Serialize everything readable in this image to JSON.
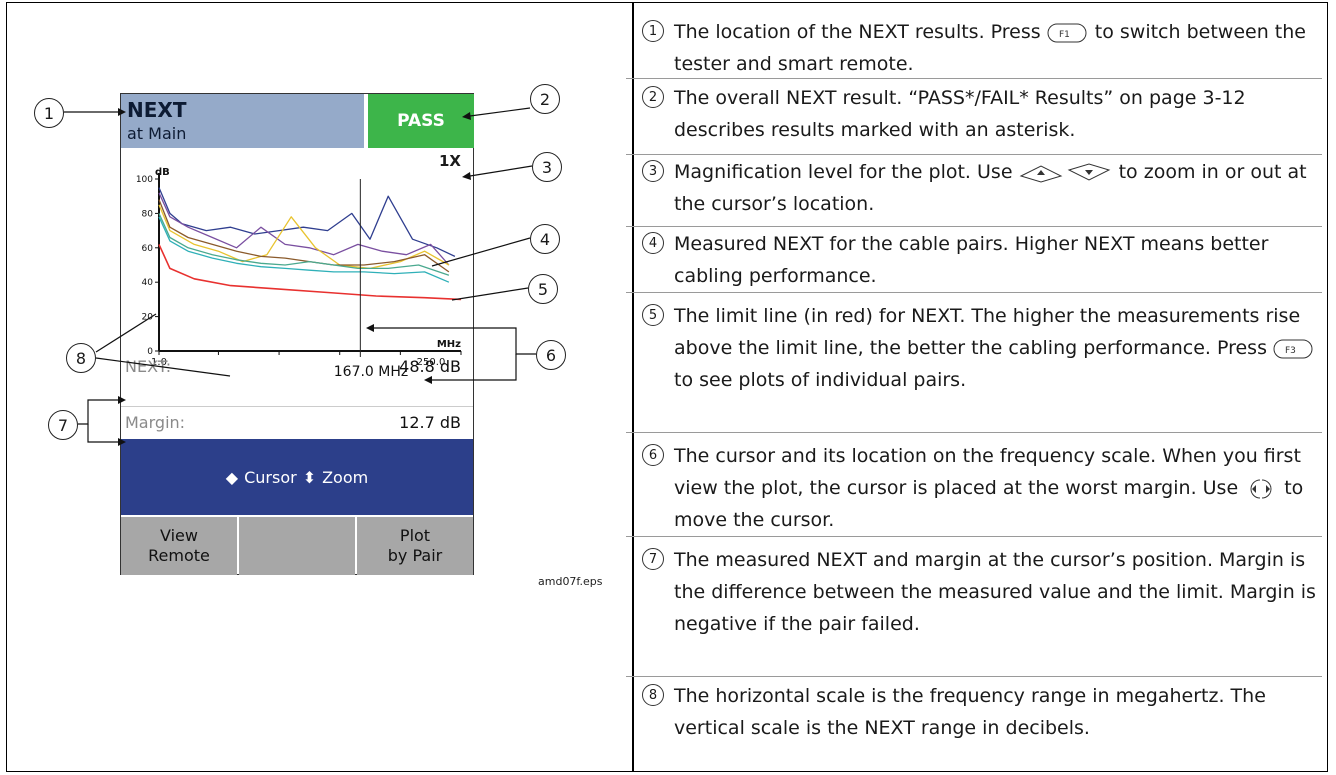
{
  "screen": {
    "title": "NEXT",
    "subtitle": "at Main",
    "result": "PASS",
    "magnification": "1X",
    "readout": [
      {
        "label": "NEXT:",
        "value": "48.8 dB"
      },
      {
        "label": "Margin:",
        "value": "12.7 dB"
      }
    ],
    "nav_bar": {
      "cursor_glyph": "◆",
      "cursor_label": "Cursor",
      "zoom_glyph": "⬍",
      "zoom_label": "Zoom"
    },
    "softkeys": [
      {
        "line1": "View",
        "line2": "Remote"
      },
      {
        "line1": "",
        "line2": ""
      },
      {
        "line1": "Plot",
        "line2": "by Pair"
      }
    ],
    "colors": {
      "header": "#95aac9",
      "pass": "#3db54a",
      "nav": "#2c3f8a",
      "softkey": "#a7a7a7",
      "limit": "#e8312f"
    }
  },
  "chart_data": {
    "type": "line",
    "ylabel": "dB",
    "xlabel": "MHz",
    "ylim": [
      0,
      100
    ],
    "xlim": [
      1.0,
      250.0
    ],
    "yticks": [
      "0",
      "20",
      "40",
      "60",
      "80",
      "100"
    ],
    "xticks": [
      "1.0",
      "250.0"
    ],
    "cursor_label": "167.0 MHz",
    "cursor_x": 167.0,
    "series": [
      {
        "color": "#e8312f",
        "values": [
          [
            1,
            62
          ],
          [
            10,
            48
          ],
          [
            30,
            42
          ],
          [
            60,
            38
          ],
          [
            100,
            36
          ],
          [
            140,
            34
          ],
          [
            180,
            32
          ],
          [
            220,
            31
          ],
          [
            250,
            30
          ]
        ]
      },
      {
        "color": "#2f3e8f",
        "values": [
          [
            1,
            95
          ],
          [
            10,
            80
          ],
          [
            20,
            74
          ],
          [
            40,
            70
          ],
          [
            60,
            72
          ],
          [
            80,
            68
          ],
          [
            100,
            70
          ],
          [
            120,
            72
          ],
          [
            140,
            70
          ],
          [
            160,
            80
          ],
          [
            175,
            65
          ],
          [
            190,
            90
          ],
          [
            210,
            65
          ],
          [
            230,
            60
          ],
          [
            245,
            55
          ]
        ]
      },
      {
        "color": "#7a4fa0",
        "values": [
          [
            1,
            92
          ],
          [
            10,
            78
          ],
          [
            25,
            72
          ],
          [
            45,
            66
          ],
          [
            65,
            60
          ],
          [
            85,
            72
          ],
          [
            105,
            62
          ],
          [
            125,
            60
          ],
          [
            145,
            56
          ],
          [
            165,
            62
          ],
          [
            185,
            58
          ],
          [
            205,
            56
          ],
          [
            225,
            62
          ],
          [
            240,
            50
          ]
        ]
      },
      {
        "color": "#e8c32f",
        "values": [
          [
            1,
            85
          ],
          [
            10,
            70
          ],
          [
            30,
            62
          ],
          [
            50,
            58
          ],
          [
            70,
            52
          ],
          [
            90,
            56
          ],
          [
            110,
            78
          ],
          [
            130,
            60
          ],
          [
            150,
            50
          ],
          [
            175,
            48
          ],
          [
            200,
            52
          ],
          [
            220,
            58
          ],
          [
            240,
            50
          ]
        ]
      },
      {
        "color": "#8a5a2b",
        "values": [
          [
            1,
            88
          ],
          [
            10,
            72
          ],
          [
            25,
            66
          ],
          [
            45,
            62
          ],
          [
            65,
            58
          ],
          [
            85,
            55
          ],
          [
            105,
            54
          ],
          [
            125,
            52
          ],
          [
            145,
            50
          ],
          [
            170,
            50
          ],
          [
            195,
            52
          ],
          [
            220,
            56
          ],
          [
            240,
            46
          ]
        ]
      },
      {
        "color": "#4aa98f",
        "values": [
          [
            1,
            80
          ],
          [
            10,
            66
          ],
          [
            25,
            60
          ],
          [
            45,
            56
          ],
          [
            65,
            53
          ],
          [
            85,
            51
          ],
          [
            105,
            50
          ],
          [
            125,
            52
          ],
          [
            145,
            50
          ],
          [
            165,
            48
          ],
          [
            190,
            48
          ],
          [
            215,
            50
          ],
          [
            240,
            44
          ]
        ]
      },
      {
        "color": "#2fb0b8",
        "values": [
          [
            1,
            78
          ],
          [
            10,
            64
          ],
          [
            25,
            58
          ],
          [
            45,
            54
          ],
          [
            65,
            51
          ],
          [
            85,
            49
          ],
          [
            105,
            48
          ],
          [
            125,
            47
          ],
          [
            145,
            46
          ],
          [
            170,
            46
          ],
          [
            195,
            45
          ],
          [
            220,
            46
          ],
          [
            240,
            40
          ]
        ]
      }
    ]
  },
  "callouts": [
    "1",
    "2",
    "3",
    "4",
    "5",
    "6",
    "7",
    "8"
  ],
  "figure_name": "amd07f.eps",
  "items": [
    {
      "num": "1",
      "text_before": "The location of the NEXT results. Press",
      "key": "F1",
      "text_after": "to switch between the tester and smart remote."
    },
    {
      "num": "2",
      "text_before": "The overall NEXT result. “PASS*/FAIL* Results” on page 3-12 describes results marked with an asterisk.",
      "key": "",
      "text_after": ""
    },
    {
      "num": "3",
      "text_before": "Magnification level for the plot. Use",
      "key": "zoom",
      "text_after": "to zoom in or out at the cursor’s location."
    },
    {
      "num": "4",
      "text_before": "Measured NEXT for the cable pairs. Higher NEXT means better cabling performance.",
      "key": "",
      "text_after": ""
    },
    {
      "num": "5",
      "text_before": "The limit line (in red) for NEXT. The higher the measurements rise above the limit line, the better the cabling performance. Press",
      "key": "F3",
      "text_after": "to see plots of individual pairs."
    },
    {
      "num": "6",
      "text_before": "The cursor and its location on the frequency scale. When you first view the plot, the cursor is placed at the worst margin. Use",
      "key": "arrows",
      "text_after": "to move the cursor."
    },
    {
      "num": "7",
      "text_before": "The measured NEXT and margin at the cursor’s position. Margin is the difference between the measured value and the limit. Margin is negative if the pair failed.",
      "key": "",
      "text_after": ""
    },
    {
      "num": "8",
      "text_before": "The horizontal scale is the frequency range in megahertz. The vertical scale is the NEXT range in decibels.",
      "key": "",
      "text_after": ""
    }
  ]
}
